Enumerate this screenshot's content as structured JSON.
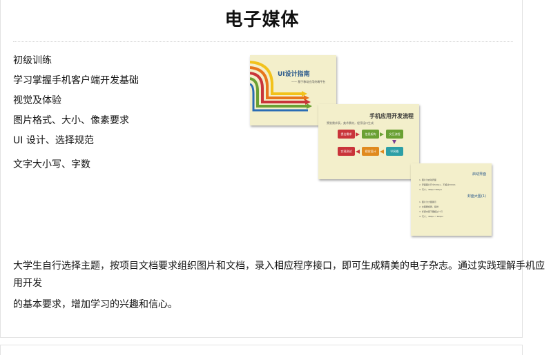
{
  "header": {
    "title": "电子媒体"
  },
  "topics": [
    "初级训练",
    "学习掌握手机客户端开发基础",
    "视觉及体验",
    "图片格式、大小、像素要求",
    "UI 设计、选择规范",
    "文字大小写、字数"
  ],
  "description": {
    "line1": "大学生自行选择主题，按项目文档要求组织图片和文档，录入相应程序接口，即可生成精美的电子杂志。通过实践理解手机应用开发",
    "line2": "的基本要求，增加学习的兴趣和信心。"
  },
  "slides": {
    "s1": {
      "title": "UI设计指南",
      "subtitle": "—— 基于移动应用终端平台"
    },
    "s2": {
      "title": "手机应用开发流程",
      "subtitle": "策划需求表，美术素材，程序接口生成",
      "steps": [
        "提出需求",
        "信息架构",
        "交互流程",
        "实现测试",
        "视觉设计",
        "UI风格"
      ]
    },
    "s3": {
      "heading1": "启动界面",
      "items1": [
        "1. 图片为启动界面",
        "2. 界面图片尺寸640px，不超过300kb",
        "3. 尺寸：480px*800px"
      ],
      "heading2": "封面大图(1)",
      "items2": [
        "1. 图片为大图展示",
        "2. 全图要横屏，竖排",
        "3. 标题内容不要超过一行",
        "4. 尺寸：480px * 800px"
      ]
    }
  },
  "colors": {
    "slide_bg": "#f3efcb",
    "box_red": "#c9343a",
    "box_green": "#6aa033",
    "box_orange": "#e08a1e",
    "box_teal": "#2d9fa6",
    "box_purple": "#7a3c8f"
  }
}
